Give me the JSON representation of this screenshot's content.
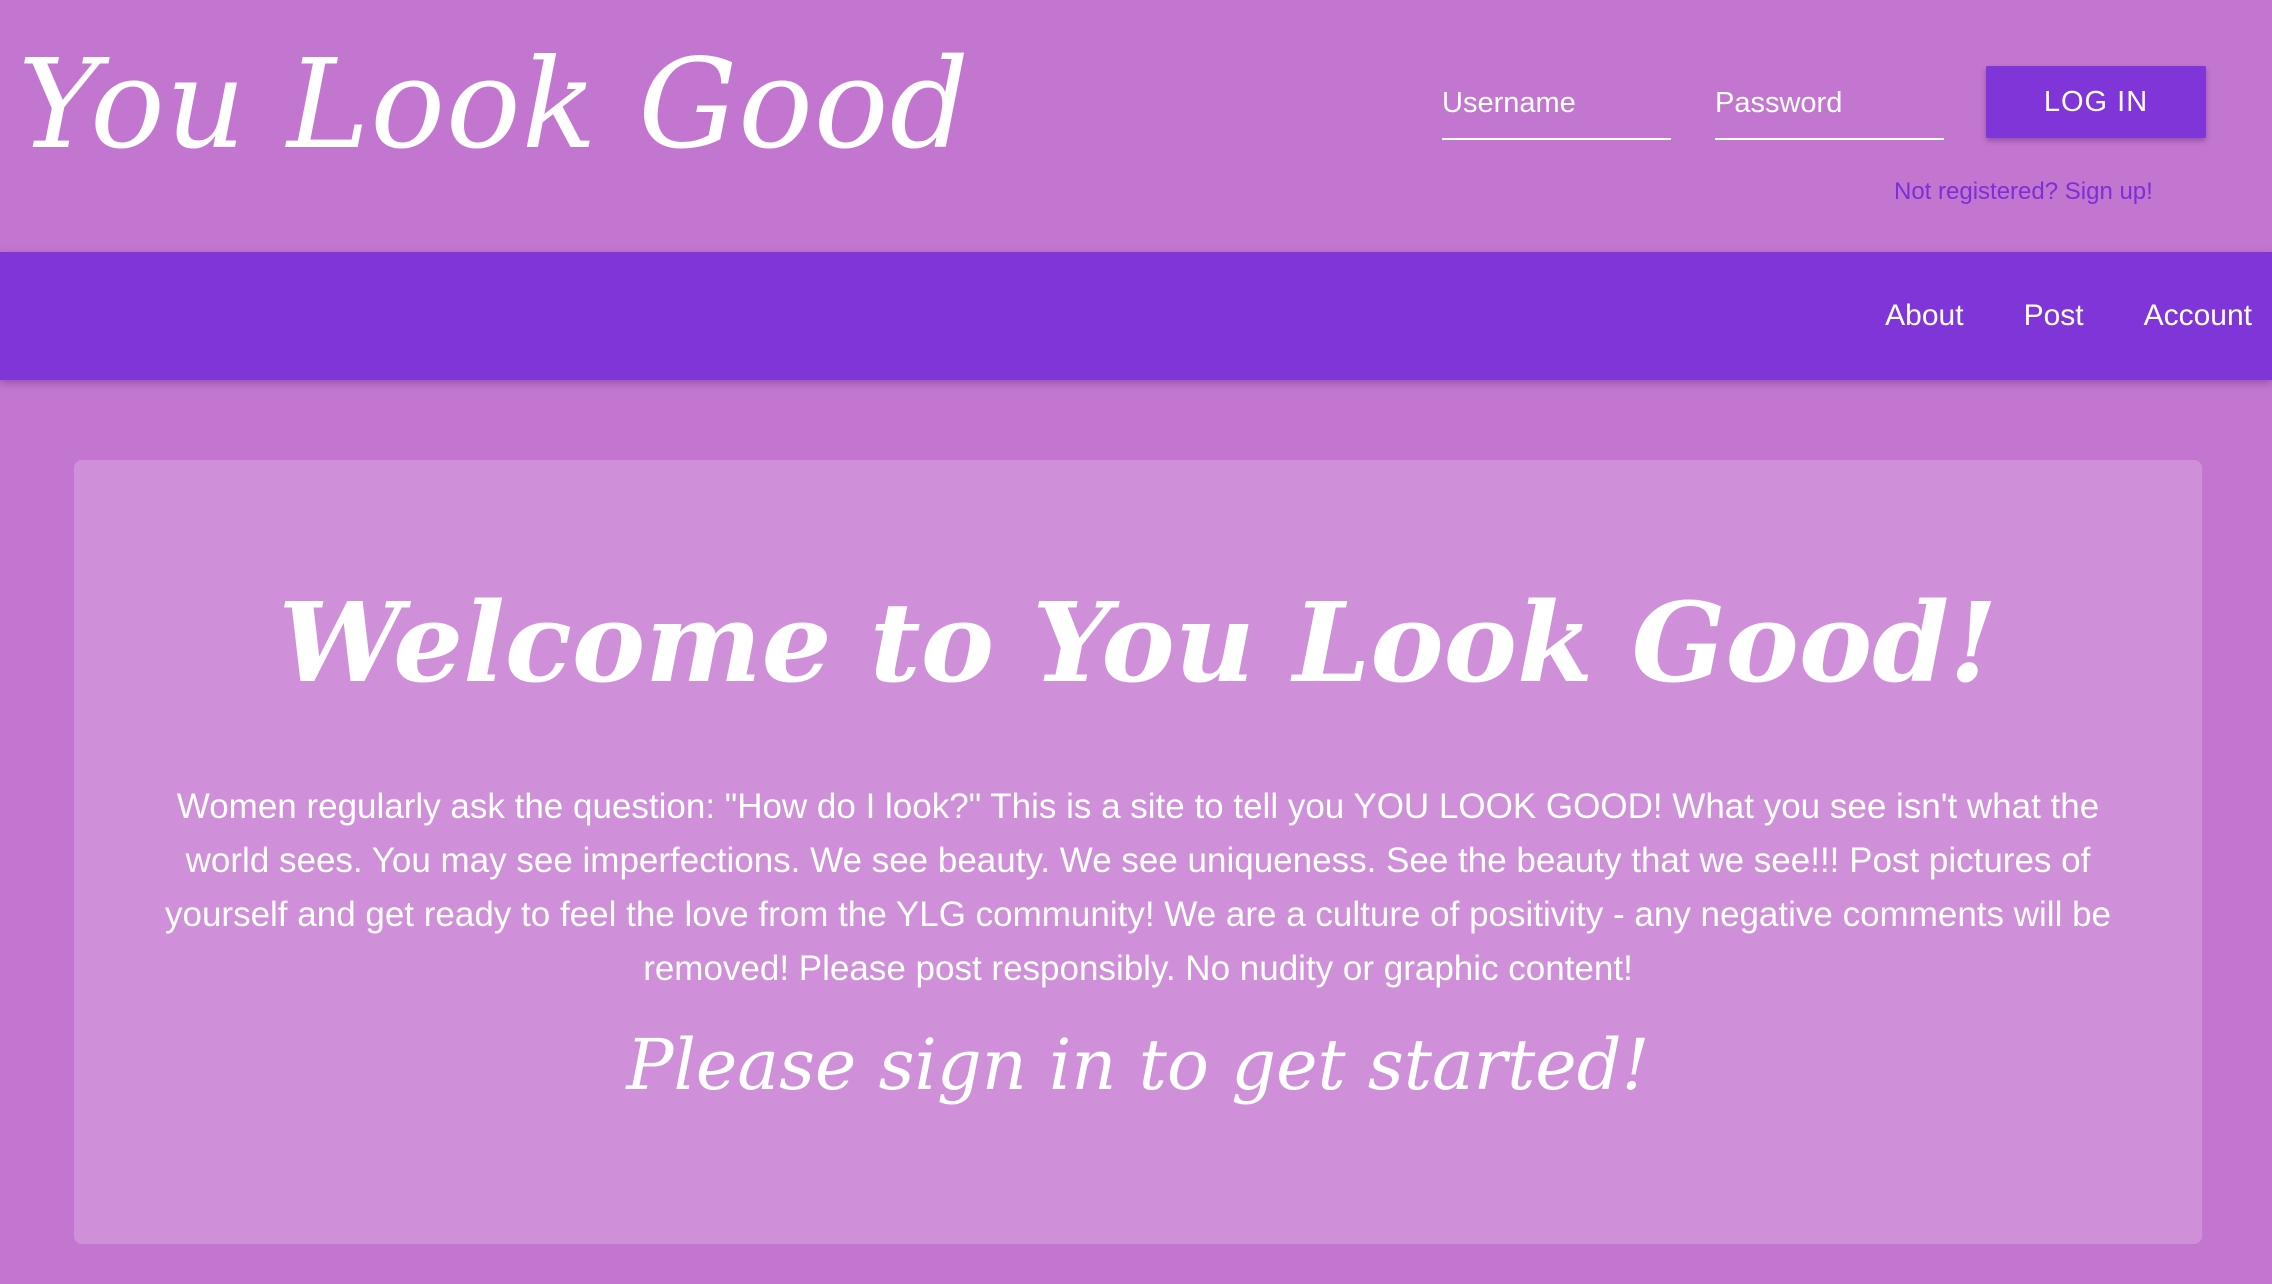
{
  "header": {
    "logo": "You Look Good",
    "login": {
      "username_placeholder": "Username",
      "password_placeholder": "Password",
      "login_label": "LOG IN",
      "signup_link": "Not registered? Sign up!"
    }
  },
  "nav": {
    "items": [
      {
        "label": "About"
      },
      {
        "label": "Post"
      },
      {
        "label": "Account"
      }
    ]
  },
  "main": {
    "title": "Welcome to You Look Good!",
    "intro": "Women regularly ask the question: \"How do I look?\" This is a site to tell you YOU LOOK GOOD! What you see isn't what the world sees. You may see imperfections. We see beauty. We see uniqueness. See the beauty that we see!!! Post pictures of yourself and get ready to feel the love from the YLG community! We are a culture of positivity - any negative comments will be removed! Please post responsibly. No nudity or graphic content!",
    "prompt": "Please sign in to get started!"
  },
  "colors": {
    "background": "#c376d0",
    "navbar": "#8035d9",
    "card": "#cf8fd9",
    "button": "#8035d9",
    "link": "#7a30d6",
    "text": "#ffffff"
  }
}
